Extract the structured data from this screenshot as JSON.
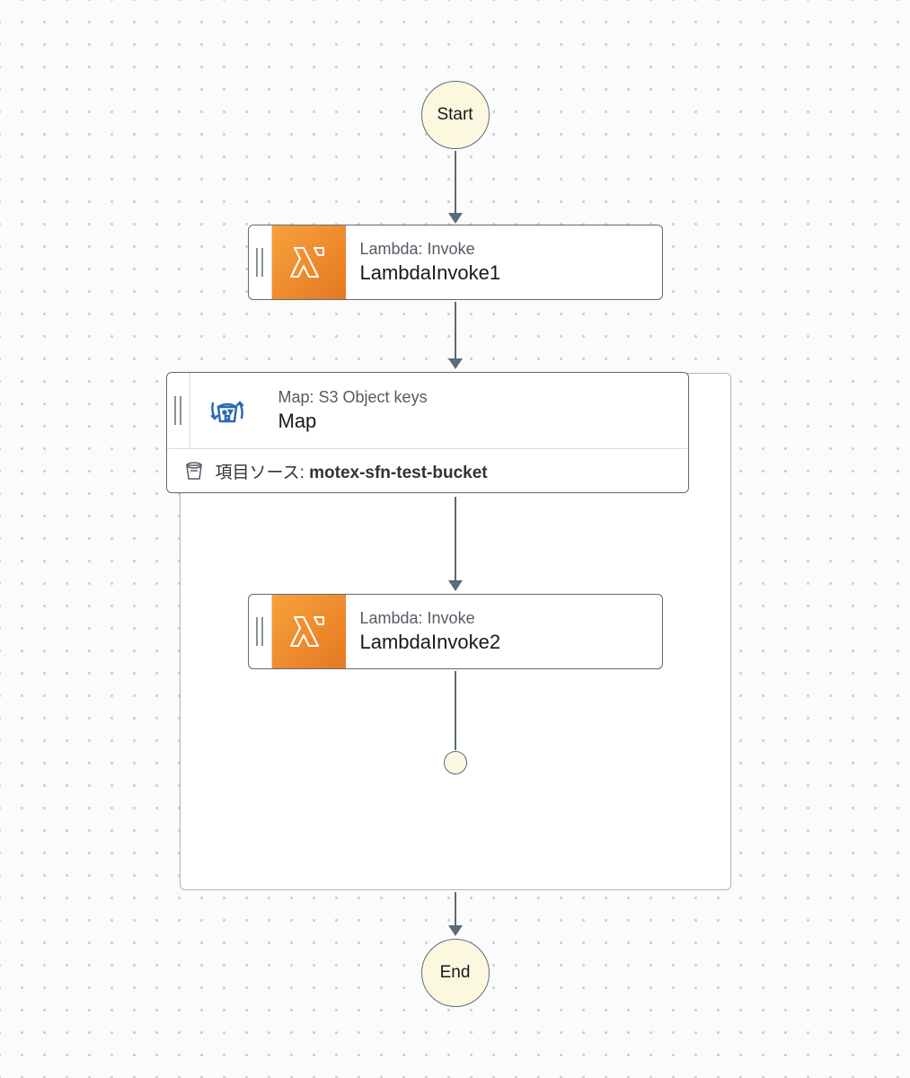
{
  "terminals": {
    "start": "Start",
    "end": "End"
  },
  "nodes": {
    "lambda1": {
      "subtitle": "Lambda: Invoke",
      "title": "LambdaInvoke1"
    },
    "map": {
      "subtitle": "Map: S3 Object keys",
      "title": "Map",
      "source_label": "項目ソース",
      "source_value": "motex-sfn-test-bucket"
    },
    "lambda2": {
      "subtitle": "Lambda: Invoke",
      "title": "LambdaInvoke2"
    }
  }
}
